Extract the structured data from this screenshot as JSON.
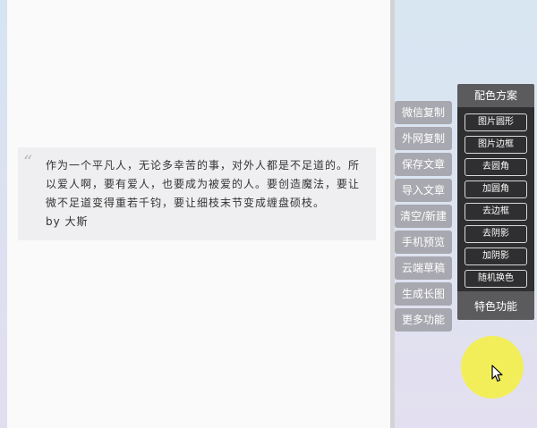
{
  "quote": {
    "mark": "“",
    "text": "作为一个平凡人，无论多幸苦的事，对外人都是不足道的。所以爱人啊，要有爱人，也要成为被爱的人。要创造魔法，要让微不足道变得重若千钧，要让细枝末节变成缠盘硕枝。",
    "author": "by 大斯"
  },
  "toolbar": {
    "items": [
      "微信复制",
      "外网复制",
      "保存文章",
      "导入文章",
      "清空/新建",
      "手机预览",
      "云端草稿",
      "生成长图",
      "更多功能"
    ]
  },
  "color_panel": {
    "title": "配色方案",
    "options": [
      "图片圆形",
      "图片边框",
      "去圆角",
      "加圆角",
      "去边框",
      "去阴影",
      "加阴影",
      "随机换色"
    ],
    "footer": "特色功能"
  },
  "colors": {
    "tool_button_bg": "#a8a8b0",
    "panel_header_bg": "#5b5b5d",
    "panel_body_bg": "#2f2f31",
    "cursor_highlight": "#f2ee5a"
  },
  "icons": {
    "cursor": "mouse-pointer-icon",
    "quote": "quotation-mark-icon"
  }
}
